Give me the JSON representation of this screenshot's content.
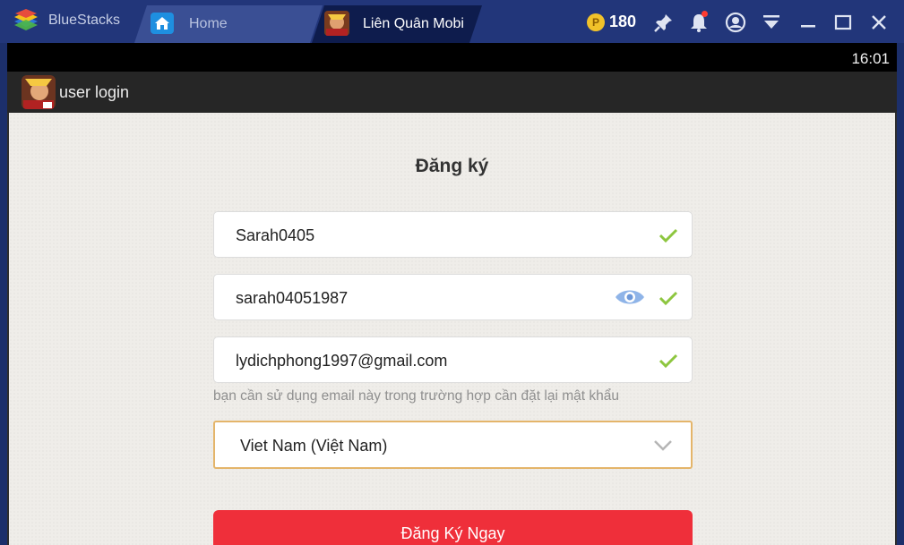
{
  "titlebar": {
    "app_name": "BlueStacks",
    "tabs": [
      {
        "label": "Home",
        "icon": "home-icon"
      },
      {
        "label": "Liên Quân Mobi",
        "icon": "game-icon"
      }
    ],
    "coin_count": "180",
    "icons": [
      "coin-icon",
      "pin-icon",
      "bell-icon",
      "account-icon",
      "menu-icon",
      "minimize-icon",
      "maximize-icon",
      "close-icon"
    ]
  },
  "status": {
    "time": "16:01"
  },
  "appbar": {
    "title": "user login"
  },
  "form": {
    "title": "Đăng ký",
    "username": "Sarah0405",
    "password": "sarah04051987",
    "email": "lydichphong1997@gmail.com",
    "email_hint": "bạn cần sử dụng email này trong trường hợp cần đặt lại mật khẩu",
    "country": "Viet Nam (Việt Nam)",
    "submit_label": "Đăng Ký Ngay"
  },
  "colors": {
    "titlebar": "#22367a",
    "accent_check": "#8dc63f",
    "submit": "#ef2f3a",
    "select_border": "#e4b56a"
  }
}
